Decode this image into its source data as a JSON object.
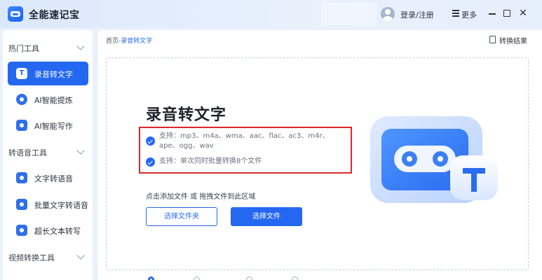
{
  "app": {
    "title": "全能速记宝"
  },
  "titlebar": {
    "login_label": "登录/注册",
    "more_label": "更多",
    "close_glyph": "✕"
  },
  "sidebar": {
    "groups": [
      {
        "label": "热门工具"
      },
      {
        "label": "转语音工具"
      },
      {
        "label": "视频转换工具"
      }
    ],
    "items": [
      {
        "label": "录音转文字",
        "icon": "record-to-text-icon",
        "active": true
      },
      {
        "label": "AI智能提炼",
        "icon": "ai-extract-icon"
      },
      {
        "label": "AI智能写作",
        "icon": "ai-write-icon"
      },
      {
        "label": "文字转语音",
        "icon": "text-to-speech-icon"
      },
      {
        "label": "批量文字转语音",
        "icon": "batch-tts-icon"
      },
      {
        "label": "超长文本转写",
        "icon": "long-text-icon"
      }
    ]
  },
  "breadcrumb": {
    "home": "首页",
    "separator": "-",
    "current": "录音转文字"
  },
  "result_link": "转换结果",
  "main": {
    "heading": "录音转文字",
    "support_formats": "支持：mp3、m4a、wma、aac、flac、ac3、m4r、ape、ogg、wav",
    "support_batch": "支持：单次同时批量转换8个文件",
    "drop_hint": "点击添加文件 或 拖拽文件到此区域",
    "btn_folder": "选择文件夹",
    "btn_file": "选择文件"
  },
  "colors": {
    "accent": "#2468f2",
    "highlight_border": "#e0272b"
  }
}
